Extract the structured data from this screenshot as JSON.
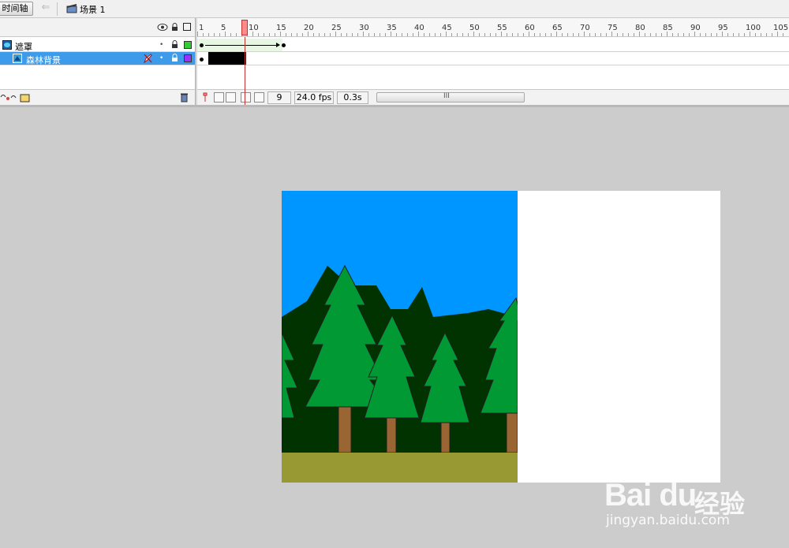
{
  "topbar": {
    "timeline_button": "时间轴",
    "scene_name": "场景 1"
  },
  "layers": [
    {
      "name": "遮罩",
      "icon": "mask-layer-icon",
      "color": "#33cc33",
      "selected": false
    },
    {
      "name": "森林背景",
      "icon": "masked-layer-icon",
      "color": "#9933ff",
      "selected": true
    }
  ],
  "ruler": {
    "labels": [
      "1",
      "5",
      "10",
      "15",
      "20",
      "25",
      "30",
      "35",
      "40",
      "45",
      "50",
      "55",
      "60",
      "65",
      "70",
      "75",
      "80",
      "85",
      "90",
      "95",
      "100",
      "105"
    ]
  },
  "footer": {
    "current_frame": "9",
    "frame_rate": "24.0 fps",
    "elapsed_time": "0.3s",
    "scroll_grip": "III"
  },
  "colors": {
    "sky": "#0096ff",
    "far_forest": "#003300",
    "tree": "#009933",
    "trunk": "#996633",
    "ground": "#999933",
    "stage_bg": "#ffffff",
    "workspace": "#cccccc"
  },
  "watermark": {
    "logo_text": "Bai du",
    "chinese_text": "经验",
    "url": "jingyan.baidu.com"
  }
}
